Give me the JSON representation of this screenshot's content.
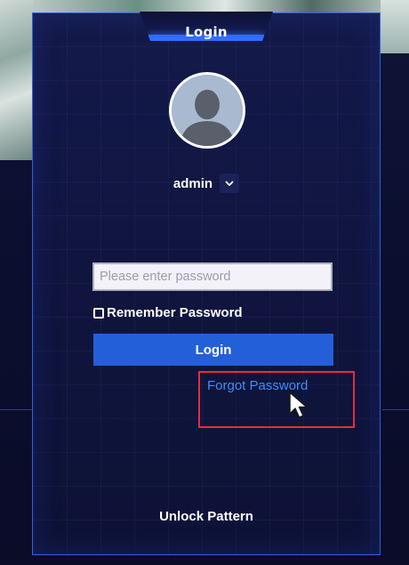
{
  "dialog": {
    "title": "Login"
  },
  "user": {
    "name": "admin",
    "avatar_icon": "user-silhouette-icon",
    "dropdown_icon": "chevron-down-icon"
  },
  "password": {
    "placeholder": "Please enter password",
    "value": ""
  },
  "remember": {
    "label": "Remember Password",
    "checked": false
  },
  "actions": {
    "login_label": "Login",
    "forgot_label": "Forgot Password",
    "unlock_label": "Unlock Pattern"
  },
  "colors": {
    "accent": "#2360d8",
    "link": "#3e8cff",
    "highlight": "#e0303a",
    "background": "#10153f"
  }
}
